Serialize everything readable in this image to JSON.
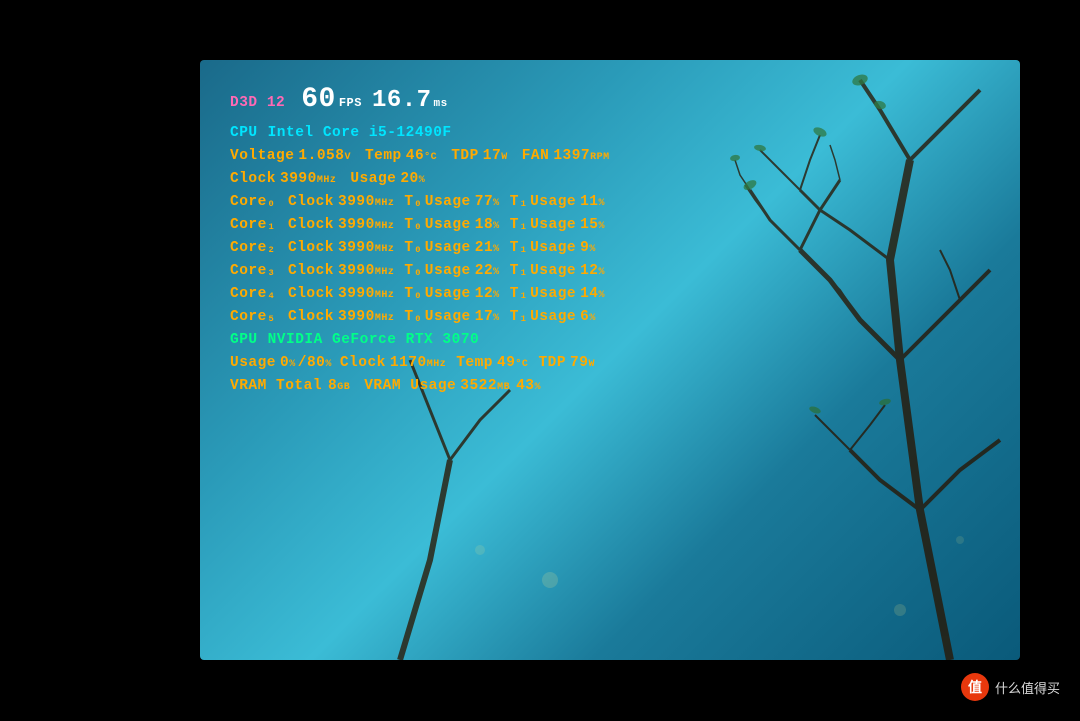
{
  "screen": {
    "bg_description": "Blue sky with tree branches"
  },
  "overlay": {
    "d3d_label": "D3D",
    "d3d_version": "12",
    "fps_value": "60",
    "fps_unit": "FPS",
    "ms_value": "16.7",
    "ms_unit": "ms",
    "cpu_label": "CPU",
    "cpu_name": "Intel Core i5-12490F",
    "voltage_label": "Voltage",
    "voltage_value": "1.058",
    "voltage_unit": "V",
    "temp_label": "Temp",
    "temp_value": "46",
    "temp_unit": "°C",
    "tdp_label": "TDP",
    "tdp_value": "17",
    "tdp_unit": "W",
    "fan_label": "FAN",
    "fan_value": "1397",
    "fan_unit": "RPM",
    "clock_label": "Clock",
    "clock_value": "3990",
    "clock_unit": "MHz",
    "usage_label": "Usage",
    "usage_value": "20",
    "usage_unit": "%",
    "cores": [
      {
        "name": "Core₀",
        "clock": "3990",
        "t0_usage": "77",
        "t1_usage": "11"
      },
      {
        "name": "Core₁",
        "clock": "3990",
        "t0_usage": "18",
        "t1_usage": "15"
      },
      {
        "name": "Core₂",
        "clock": "3990",
        "t0_usage": "21",
        "t1_usage": "9"
      },
      {
        "name": "Core₃",
        "clock": "3990",
        "t0_usage": "22",
        "t1_usage": "12"
      },
      {
        "name": "Core₄",
        "clock": "3990",
        "t0_usage": "12",
        "t1_usage": "14"
      },
      {
        "name": "Core₅",
        "clock": "3990",
        "t0_usage": "17",
        "t1_usage": "6"
      }
    ],
    "gpu_label": "GPU",
    "gpu_name": "NVIDIA GeForce RTX 3070",
    "gpu_usage": "0",
    "gpu_usage2": "80",
    "gpu_clock": "1170",
    "gpu_temp": "49",
    "gpu_tdp": "79",
    "vram_total_label": "VRAM Total",
    "vram_total_value": "8",
    "vram_total_unit": "GB",
    "vram_usage_label": "VRAM Usage",
    "vram_usage_value": "3522",
    "vram_usage_unit": "MB",
    "vram_usage_pct": "43"
  },
  "watermark": {
    "icon": "值",
    "text": "什么值得买"
  }
}
